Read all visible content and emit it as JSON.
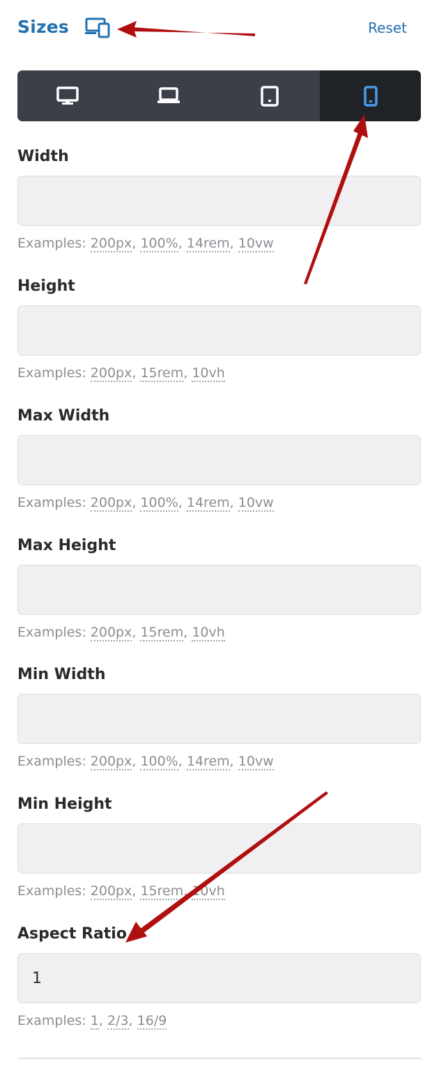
{
  "header": {
    "title": "Sizes",
    "reset_label": "Reset"
  },
  "device_tabs": [
    {
      "name": "desktop",
      "icon": "desktop-icon",
      "active": false
    },
    {
      "name": "laptop",
      "icon": "laptop-icon",
      "active": false
    },
    {
      "name": "tablet",
      "icon": "tablet-icon",
      "active": false
    },
    {
      "name": "mobile",
      "icon": "mobile-icon",
      "active": true
    }
  ],
  "fields": [
    {
      "label": "Width",
      "value": "",
      "examples_prefix": "Examples:",
      "examples": [
        "200px",
        "100%",
        "14rem",
        "10vw"
      ]
    },
    {
      "label": "Height",
      "value": "",
      "examples_prefix": "Examples:",
      "examples": [
        "200px",
        "15rem",
        "10vh"
      ]
    },
    {
      "label": "Max Width",
      "value": "",
      "examples_prefix": "Examples:",
      "examples": [
        "200px",
        "100%",
        "14rem",
        "10vw"
      ]
    },
    {
      "label": "Max Height",
      "value": "",
      "examples_prefix": "Examples:",
      "examples": [
        "200px",
        "15rem",
        "10vh"
      ]
    },
    {
      "label": "Min Width",
      "value": "",
      "examples_prefix": "Examples:",
      "examples": [
        "200px",
        "100%",
        "14rem",
        "10vw"
      ]
    },
    {
      "label": "Min Height",
      "value": "",
      "examples_prefix": "Examples:",
      "examples": [
        "200px",
        "15rem",
        "10vh"
      ]
    },
    {
      "label": "Aspect Ratio",
      "value": "1",
      "examples_prefix": "Examples:",
      "examples": [
        "1",
        "2/3",
        "16/9"
      ]
    }
  ],
  "colors": {
    "accent": "#2271b1",
    "device_bar": "#3b4048",
    "device_active": "#1f2328",
    "active_icon": "#4a9ce8",
    "annotation_arrow": "#b00f0f"
  }
}
